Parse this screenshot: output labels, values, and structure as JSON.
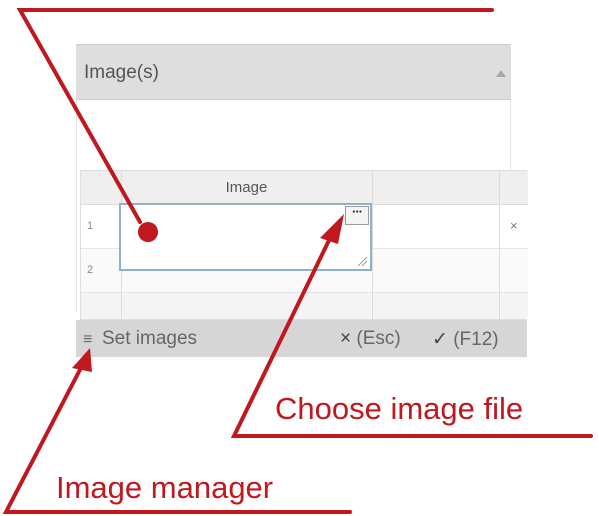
{
  "panel": {
    "title": "Image(s)"
  },
  "grid": {
    "columns": [
      "Image",
      ""
    ],
    "rows": [
      {
        "number": "1",
        "delete": "×"
      },
      {
        "number": "2",
        "delete": ""
      }
    ],
    "choose_button": "···"
  },
  "footer": {
    "menu_icon": "≡",
    "set_images": "Set images",
    "cancel_glyph": "×",
    "cancel_label": "(Esc)",
    "confirm_glyph": "✓",
    "confirm_label": "(F12)"
  },
  "annotations": {
    "choose_image_file": "Choose image file",
    "image_manager": "Image manager",
    "color": "#c0181f"
  },
  "icons": {
    "collapse": "triangle-up-icon",
    "menu": "hamburger-menu-icon",
    "choose": "ellipsis-icon",
    "delete": "close-icon",
    "resize": "resize-grip-icon"
  }
}
